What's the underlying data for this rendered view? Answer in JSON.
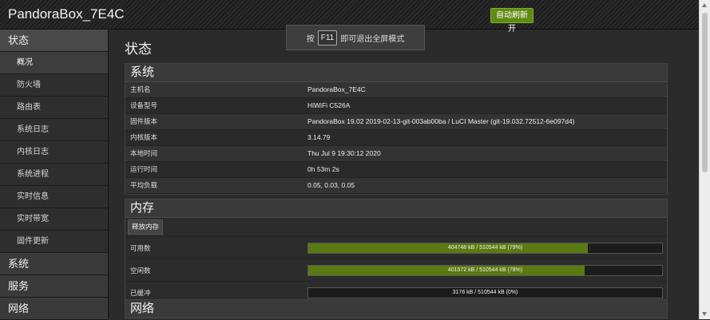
{
  "header": {
    "brand": "PandoraBox_7E4C",
    "refresh_label": "自动刷新 开"
  },
  "toast": {
    "prefix": "按",
    "key": "F11",
    "suffix": "即可退出全屏模式"
  },
  "sidebar": {
    "status_label": "状态",
    "status_items": [
      "概况",
      "防火墙",
      "路由表",
      "系统日志",
      "内核日志",
      "系统进程",
      "实时信息",
      "实时带宽",
      "固件更新"
    ],
    "sections": [
      "系统",
      "服务",
      "网络"
    ]
  },
  "main": {
    "page_title": "状态",
    "system": {
      "title": "系统",
      "rows": [
        {
          "k": "主机名",
          "v": "PandoraBox_7E4C"
        },
        {
          "k": "设备型号",
          "v": "HiWiFi C526A"
        },
        {
          "k": "固件版本",
          "v": "PandoraBox 19.02 2019-02-13-git-003ab00ba / LuCI Master (git-19.032.72512-6e097d4)"
        },
        {
          "k": "内核版本",
          "v": "3.14.79"
        },
        {
          "k": "本地时间",
          "v": "Thu Jul 9 19:30:12 2020"
        },
        {
          "k": "运行时间",
          "v": "0h 53m 2s"
        },
        {
          "k": "平均负载",
          "v": "0.05, 0.03, 0.05"
        }
      ]
    },
    "memory": {
      "title": "内存",
      "release_label": "释放内存",
      "bars": [
        {
          "k": "可用数",
          "text": "404748 kB / 510544 kB (79%)",
          "fill": 0.79
        },
        {
          "k": "空闲数",
          "text": "401572 kB / 510544 kB (78%)",
          "fill": 0.78
        },
        {
          "k": "已缓冲",
          "text": "3176 kB / 510544 kB (0%)",
          "fill": 0.0
        }
      ]
    },
    "network": {
      "title": "网络"
    }
  },
  "colors": {
    "accent_green": "#5f8a14",
    "bar_fill": "#5a7a12"
  }
}
